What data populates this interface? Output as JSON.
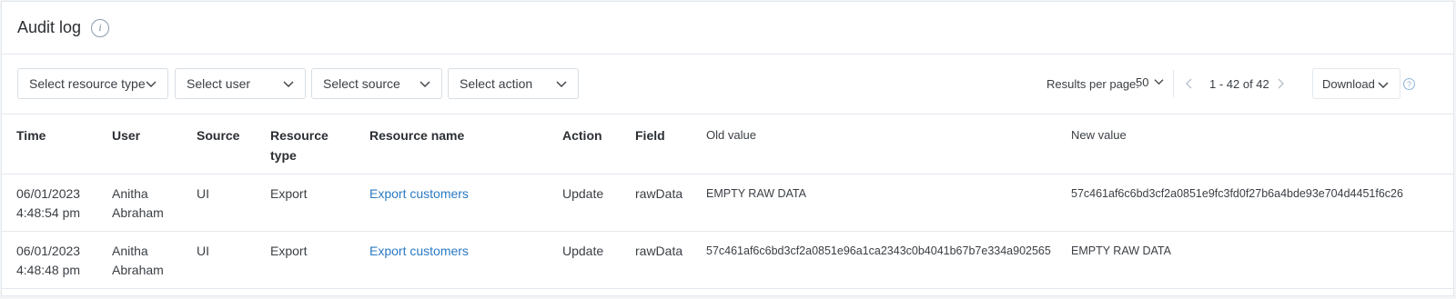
{
  "header": {
    "title": "Audit log",
    "info_glyph": "i"
  },
  "filters": [
    {
      "label": "Select resource type"
    },
    {
      "label": "Select user"
    },
    {
      "label": "Select source"
    },
    {
      "label": "Select action"
    }
  ],
  "pagination": {
    "results_label": "Results per page:",
    "per_page": "50",
    "range": "1 - 42 of 42"
  },
  "download": {
    "label": "Download"
  },
  "help_glyph": "?",
  "columns": [
    {
      "label": "Time"
    },
    {
      "label": "User"
    },
    {
      "label": "Source"
    },
    {
      "label": "Resource type"
    },
    {
      "label": "Resource name"
    },
    {
      "label": "Action"
    },
    {
      "label": "Field"
    },
    {
      "label": "Old value"
    },
    {
      "label": "New value"
    }
  ],
  "rows": [
    {
      "time_date": "06/01/2023",
      "time_clock": "4:48:54 pm",
      "user_first": "Anitha",
      "user_last": "Abraham",
      "source": "UI",
      "resource_type": "Export",
      "resource_name": "Export customers",
      "action": "Update",
      "field": "rawData",
      "old_value": "EMPTY RAW DATA",
      "new_value": "57c461af6c6bd3cf2a0851e9fc3fd0f27b6a4bde93e704d4451f6c26"
    },
    {
      "time_date": "06/01/2023",
      "time_clock": "4:48:48 pm",
      "user_first": "Anitha",
      "user_last": "Abraham",
      "source": "UI",
      "resource_type": "Export",
      "resource_name": "Export customers",
      "action": "Update",
      "field": "rawData",
      "old_value": "57c461af6c6bd3cf2a0851e96a1ca2343c0b4041b67b7e334a902565",
      "new_value": "EMPTY RAW DATA"
    }
  ],
  "colors": {
    "link": "#2a7ac2",
    "border": "#e3e8ee",
    "text": "#2b2f33"
  }
}
